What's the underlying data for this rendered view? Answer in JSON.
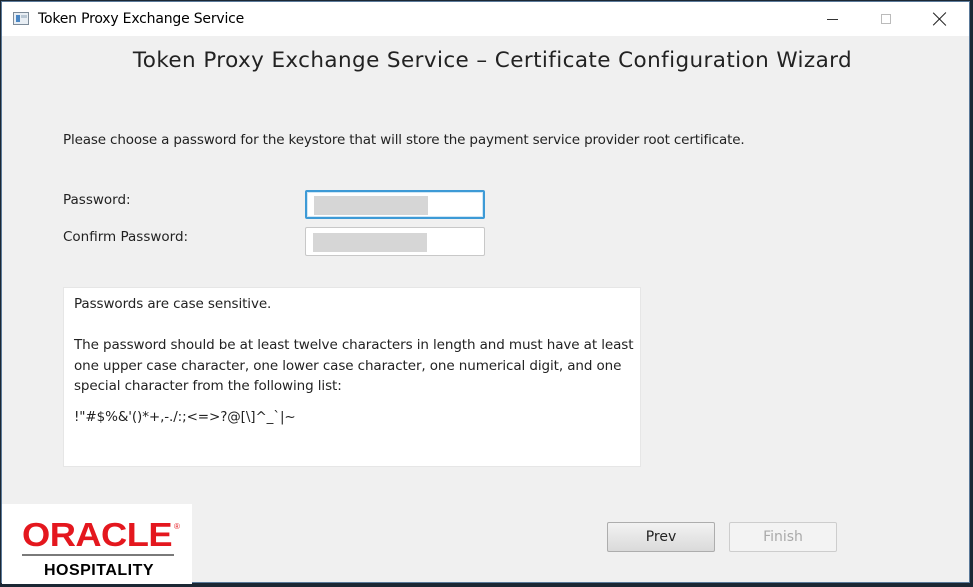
{
  "window": {
    "title": "Token Proxy Exchange Service",
    "controls": {
      "minimize_icon": "minimize-icon",
      "maximize_icon": "maximize-icon",
      "close_icon": "close-icon"
    }
  },
  "wizard": {
    "heading": "Token Proxy Exchange Service – Certificate Configuration Wizard",
    "instruction": "Please choose a password for the keystore that will store the payment service provider root certificate."
  },
  "form": {
    "password_label": "Password:",
    "confirm_label": "Confirm Password:",
    "password_value": "",
    "confirm_value": ""
  },
  "info": {
    "line1": "Passwords are case sensitive.",
    "line2": "The password should be at least twelve characters in length and must have at least one upper case character, one lower case character, one numerical digit, and one special character from the following list:",
    "line3": "!\"#$%&'()*+,-./:;<=>?@[\\]^_`|~"
  },
  "logo": {
    "brand": "ORACLE",
    "registered": "®",
    "division": "HOSPITALITY",
    "brand_color": "#e4171e"
  },
  "buttons": {
    "prev": "Prev",
    "finish": "Finish",
    "finish_enabled": false
  },
  "colors": {
    "focus_border": "#3d9ad6",
    "background": "#f0f0f0"
  }
}
